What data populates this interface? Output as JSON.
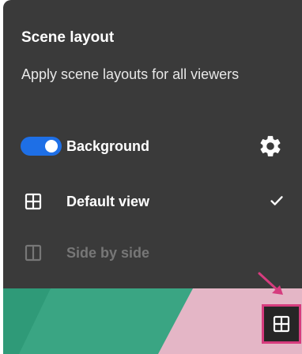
{
  "panel": {
    "title": "Scene layout",
    "subtitle": "Apply scene layouts for all viewers"
  },
  "background_row": {
    "label": "Background",
    "toggle_on": true,
    "toggle_color": "#1e6fe6",
    "settings_icon": "gear-icon"
  },
  "layouts": [
    {
      "label": "Default view",
      "icon": "grid-layout-icon",
      "selected": true
    },
    {
      "label": "Side by side",
      "icon": "split-layout-icon",
      "selected": false
    }
  ],
  "corner_button": {
    "icon": "grid-layout-icon",
    "highlight_color": "#d63c7e"
  },
  "colors": {
    "panel_bg": "#3a3a3a",
    "text_primary": "#ffffff",
    "text_disabled": "#777777"
  }
}
